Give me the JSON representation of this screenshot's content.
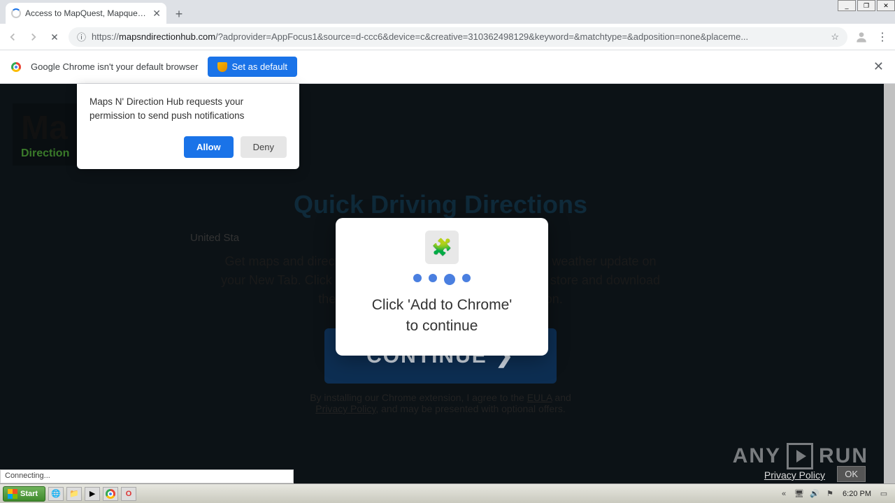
{
  "window": {
    "min": "_",
    "max": "❐",
    "close": "✕"
  },
  "tab": {
    "title": "Access to MapQuest, Mapquest Driv"
  },
  "toolbar": {
    "url_prefix": "https://",
    "url_host": "mapsndirectionhub.com",
    "url_rest": "/?adprovider=AppFocus1&source=d-ccc6&device=c&creative=310362498129&keyword=&matchtype=&adposition=none&placeme..."
  },
  "infobar": {
    "text": "Google Chrome isn't your default browser",
    "button": "Set as default"
  },
  "push": {
    "text": "Maps N' Direction Hub requests your permission to send push notifications",
    "allow": "Allow",
    "deny": "Deny"
  },
  "page": {
    "logo_big": "Ma",
    "logo_sub": "Direction",
    "heading": "Quick Driving Directions",
    "us": "United Sta",
    "para": "Get maps and directions, check traffic, and more — plus a weather update on your New Tab. Click continue below to go to the Chrome™ store and download the FREE Maps N' Direction Hub extension.",
    "continue": "CONTINUE",
    "agree_pre": "By installing our Chrome extension, I agree to the ",
    "eula": "EULA",
    "agree_mid": " and ",
    "privacy": "Privacy Policy",
    "agree_post": ", and may be presented with optional offers.",
    "footer_privacy": "Privacy Policy",
    "footer_ok": "OK"
  },
  "modal": {
    "msg_l1": "Click 'Add to Chrome'",
    "msg_l2": "to continue"
  },
  "watermark": {
    "a": "ANY",
    "b": "RUN"
  },
  "status": {
    "text": "Connecting..."
  },
  "taskbar": {
    "start": "Start",
    "clock": "6:20 PM"
  }
}
